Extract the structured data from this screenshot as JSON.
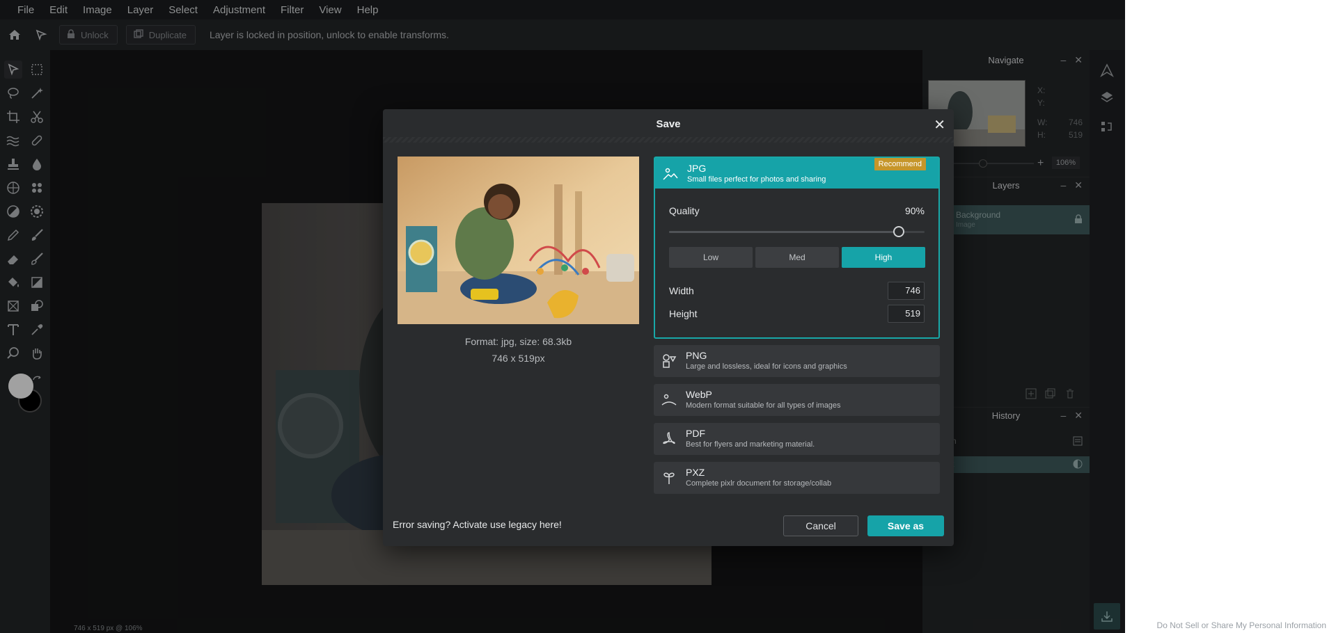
{
  "menu": [
    "File",
    "Edit",
    "Image",
    "Layer",
    "Select",
    "Adjustment",
    "Filter",
    "View",
    "Help"
  ],
  "toolbar": {
    "unlock_label": "Unlock",
    "duplicate_label": "Duplicate",
    "message": "Layer is locked in position, unlock to enable transforms."
  },
  "status": "746 x 519 px @ 106%",
  "navigate": {
    "title": "Navigate",
    "x_label": "X:",
    "y_label": "Y:",
    "w_label": "W:",
    "w_value": "746",
    "h_label": "H:",
    "h_value": "519",
    "zoom": "106%"
  },
  "layers": {
    "title": "Layers",
    "items": [
      {
        "name": "Background",
        "type": "Image"
      }
    ]
  },
  "history": {
    "title": "History",
    "items": [
      "n",
      "t"
    ]
  },
  "cookie_link": "Do Not Sell or Share My Personal Information",
  "dialog": {
    "title": "Save",
    "preview_format": "Format: jpg, size: 68.3kb",
    "preview_dims": "746 x 519px",
    "formats": [
      {
        "name": "JPG",
        "desc": "Small files perfect for photos and sharing",
        "icon": "image-icon",
        "badge": "Recommend",
        "selected": true
      },
      {
        "name": "PNG",
        "desc": "Large and lossless, ideal for icons and graphics",
        "icon": "shapes-icon"
      },
      {
        "name": "WebP",
        "desc": "Modern format suitable for all types of images",
        "icon": "webp-icon"
      },
      {
        "name": "PDF",
        "desc": "Best for flyers and marketing material.",
        "icon": "pdf-icon"
      },
      {
        "name": "PXZ",
        "desc": "Complete pixlr document for storage/collab",
        "icon": "pxz-icon"
      }
    ],
    "quality_label": "Quality",
    "quality_value": "90%",
    "quality_level": 0.9,
    "quality_presets": [
      "Low",
      "Med",
      "High"
    ],
    "quality_selected": "High",
    "width_label": "Width",
    "width_value": "746",
    "height_label": "Height",
    "height_value": "519",
    "error_msg": "Error saving? Activate use legacy here!",
    "cancel_label": "Cancel",
    "save_label": "Save as"
  },
  "colors": {
    "accent": "#16a3a8",
    "badge": "#c6962a"
  }
}
